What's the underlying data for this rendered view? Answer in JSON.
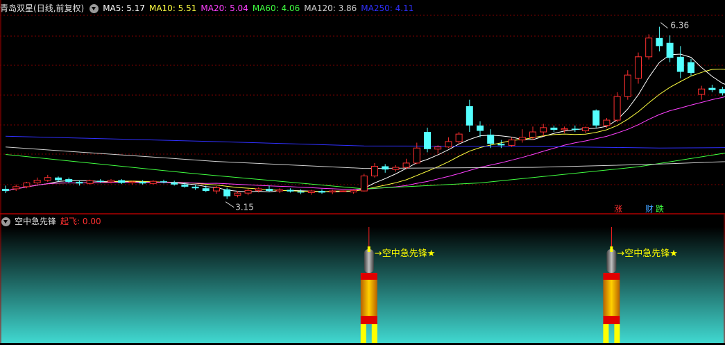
{
  "stock": {
    "name": "青岛双星",
    "period": "(日线,前复权)"
  },
  "ma_legend": [
    {
      "label": "MA5: 5.17",
      "color": "#ffffff"
    },
    {
      "label": "MA10: 5.51",
      "color": "#ffff40"
    },
    {
      "label": "MA20: 5.04",
      "color": "#ff40ff"
    },
    {
      "label": "MA60: 4.06",
      "color": "#40ff40"
    },
    {
      "label": "MA120: 3.86",
      "color": "#d0d0d0"
    },
    {
      "label": "MA250: 4.11",
      "color": "#3030ff"
    }
  ],
  "indicator": {
    "name": "空中急先锋",
    "value_label": "起飞: 0.00",
    "signal_text": "→空中急先锋★"
  },
  "badges": {
    "zhang": "涨",
    "cai": "财",
    "die": "跌"
  },
  "colors": {
    "up": "#ff3030",
    "down": "#54ffff",
    "grid": "#800000",
    "border": "#b00000"
  },
  "chart_data": {
    "type": "candlestick",
    "ylim": [
      2.9,
      6.6
    ],
    "annotations": [
      {
        "text": "6.36",
        "type": "high"
      },
      {
        "text": "3.15",
        "type": "low"
      }
    ],
    "candles": [
      [
        3.34,
        3.4,
        3.26,
        3.3
      ],
      [
        3.34,
        3.42,
        3.3,
        3.38
      ],
      [
        3.38,
        3.47,
        3.35,
        3.45
      ],
      [
        3.45,
        3.55,
        3.42,
        3.5
      ],
      [
        3.5,
        3.6,
        3.47,
        3.55
      ],
      [
        3.55,
        3.57,
        3.47,
        3.5
      ],
      [
        3.52,
        3.55,
        3.44,
        3.47
      ],
      [
        3.47,
        3.5,
        3.4,
        3.44
      ],
      [
        3.44,
        3.51,
        3.42,
        3.49
      ],
      [
        3.49,
        3.52,
        3.45,
        3.47
      ],
      [
        3.47,
        3.52,
        3.44,
        3.5
      ],
      [
        3.5,
        3.52,
        3.43,
        3.45
      ],
      [
        3.45,
        3.49,
        3.42,
        3.47
      ],
      [
        3.47,
        3.5,
        3.42,
        3.44
      ],
      [
        3.44,
        3.5,
        3.42,
        3.48
      ],
      [
        3.48,
        3.51,
        3.44,
        3.46
      ],
      [
        3.46,
        3.49,
        3.4,
        3.42
      ],
      [
        3.42,
        3.46,
        3.36,
        3.38
      ],
      [
        3.38,
        3.42,
        3.32,
        3.35
      ],
      [
        3.35,
        3.4,
        3.28,
        3.3
      ],
      [
        3.3,
        3.39,
        3.25,
        3.36
      ],
      [
        3.33,
        3.36,
        3.15,
        3.2
      ],
      [
        3.22,
        3.3,
        3.18,
        3.26
      ],
      [
        3.26,
        3.34,
        3.22,
        3.31
      ],
      [
        3.31,
        3.37,
        3.27,
        3.34
      ],
      [
        3.34,
        3.4,
        3.28,
        3.3
      ],
      [
        3.3,
        3.35,
        3.26,
        3.32
      ],
      [
        3.32,
        3.35,
        3.27,
        3.29
      ],
      [
        3.29,
        3.33,
        3.24,
        3.27
      ],
      [
        3.27,
        3.32,
        3.23,
        3.3
      ],
      [
        3.3,
        3.33,
        3.25,
        3.27
      ],
      [
        3.28,
        3.32,
        3.24,
        3.3
      ],
      [
        3.3,
        3.31,
        3.28,
        3.3
      ],
      [
        3.28,
        3.32,
        3.25,
        3.31
      ],
      [
        3.3,
        3.62,
        3.29,
        3.58
      ],
      [
        3.58,
        3.82,
        3.55,
        3.76
      ],
      [
        3.76,
        3.8,
        3.64,
        3.7
      ],
      [
        3.7,
        3.78,
        3.66,
        3.74
      ],
      [
        3.74,
        3.9,
        3.7,
        3.82
      ],
      [
        3.82,
        4.2,
        3.8,
        4.1
      ],
      [
        4.4,
        4.48,
        4.02,
        4.08
      ],
      [
        4.08,
        4.15,
        4.0,
        4.12
      ],
      [
        4.12,
        4.3,
        4.1,
        4.22
      ],
      [
        4.22,
        4.4,
        4.18,
        4.36
      ],
      [
        4.88,
        5.0,
        4.4,
        4.52
      ],
      [
        4.52,
        4.6,
        4.3,
        4.42
      ],
      [
        4.35,
        4.45,
        4.1,
        4.18
      ],
      [
        4.18,
        4.25,
        4.1,
        4.15
      ],
      [
        4.15,
        4.3,
        4.12,
        4.25
      ],
      [
        4.25,
        4.45,
        4.2,
        4.3
      ],
      [
        4.3,
        4.5,
        4.25,
        4.4
      ],
      [
        4.4,
        4.55,
        4.32,
        4.48
      ],
      [
        4.48,
        4.52,
        4.4,
        4.44
      ],
      [
        4.44,
        4.5,
        4.38,
        4.46
      ],
      [
        4.46,
        4.52,
        4.4,
        4.44
      ],
      [
        4.42,
        4.5,
        4.38,
        4.48
      ],
      [
        4.8,
        4.82,
        4.48,
        4.52
      ],
      [
        4.52,
        4.66,
        4.48,
        4.62
      ],
      [
        4.62,
        5.14,
        4.58,
        5.06
      ],
      [
        5.06,
        5.55,
        5.0,
        5.46
      ],
      [
        5.4,
        5.88,
        5.3,
        5.8
      ],
      [
        5.8,
        6.22,
        5.75,
        6.15
      ],
      [
        6.15,
        6.36,
        5.9,
        6.0
      ],
      [
        6.06,
        6.2,
        5.7,
        5.78
      ],
      [
        5.8,
        6.0,
        5.4,
        5.52
      ],
      [
        5.7,
        5.76,
        5.45,
        5.5
      ],
      [
        5.1,
        5.26,
        5.0,
        5.2
      ],
      [
        5.22,
        5.28,
        5.14,
        5.18
      ],
      [
        5.2,
        5.24,
        5.08,
        5.12
      ],
      [
        5.14,
        5.28,
        5.06,
        5.2
      ],
      [
        5.22,
        5.46,
        5.1,
        5.3
      ]
    ],
    "ma_last": {
      "MA5": 5.17,
      "MA10": 5.51,
      "MA20": 5.04,
      "MA60": 4.06,
      "MA120": 3.86,
      "MA250": 4.11
    },
    "signal_bars": [
      34,
      57
    ],
    "signal_value": 0.0
  }
}
